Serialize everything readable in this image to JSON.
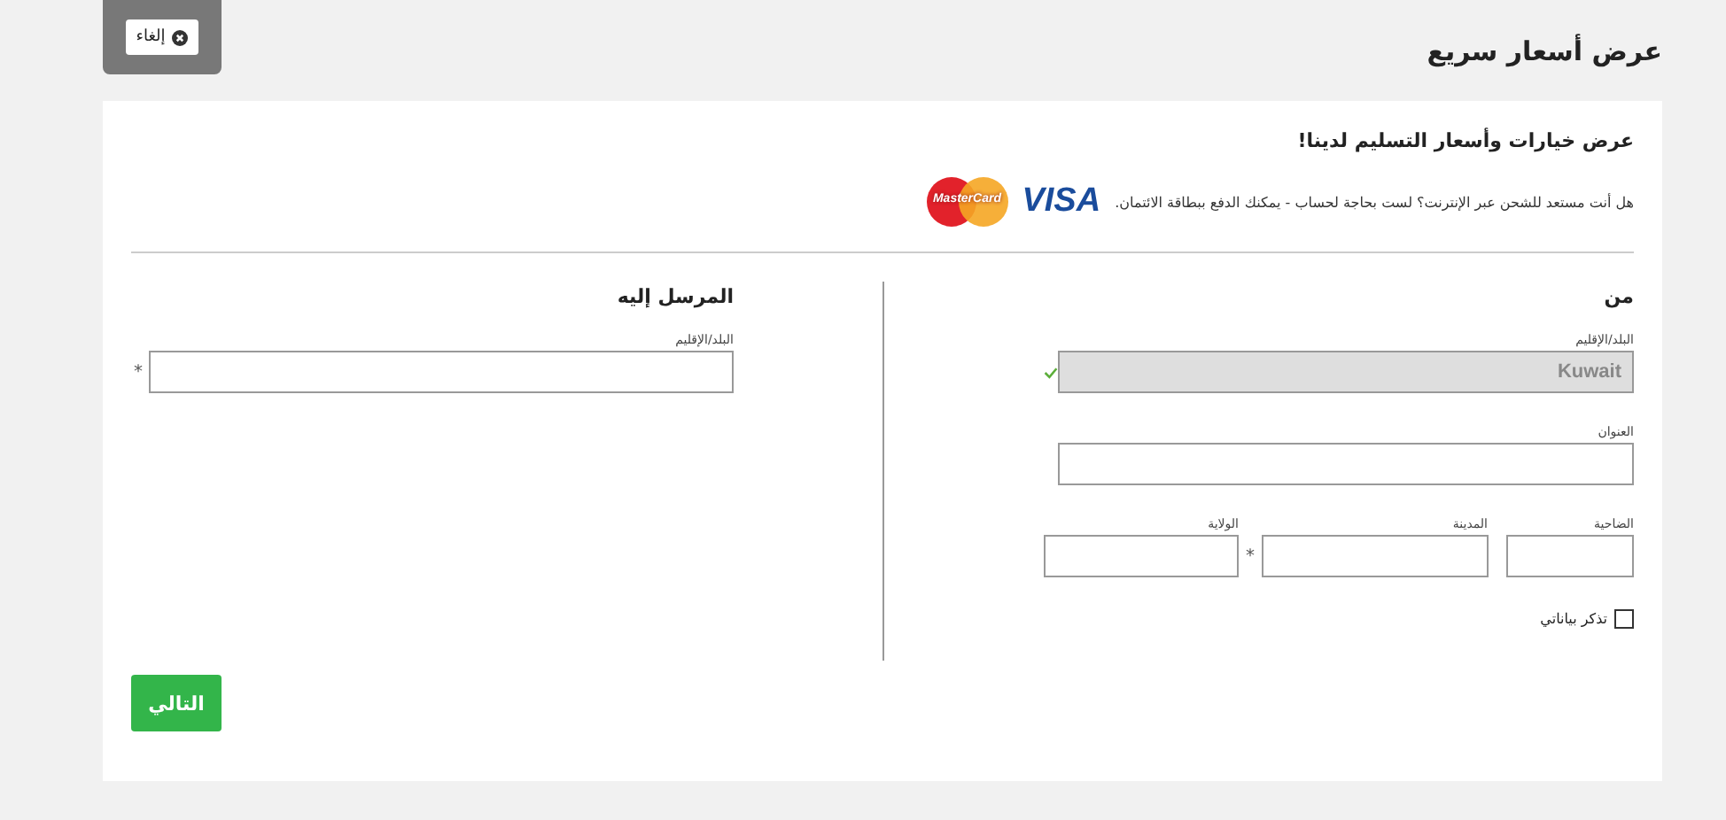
{
  "header": {
    "title": "عرض أسعار سريع",
    "cancel_button": "إلغاء"
  },
  "intro": {
    "title": "عرض خيارات وأسعار التسليم لدينا!",
    "text": "هل أنت مستعد للشحن عبر الإنترنت؟ لست بحاجة لحساب - يمكنك الدفع ببطاقة الائتمان.",
    "logos": [
      {
        "kind": "visa",
        "label": "VISA"
      },
      {
        "kind": "mastercard",
        "label": "MasterCard"
      }
    ]
  },
  "sender": {
    "title": "من",
    "rows": [
      [
        {
          "label": "البلد/الإقليم",
          "value": "Kuwait",
          "disabled": true,
          "verified": true
        }
      ],
      [
        {
          "label": "العنوان",
          "disabled": false,
          "verified": false
        }
      ],
      [
        {
          "label": "الضاحية",
          "disabled": false,
          "verified": false
        },
        {
          "label": "المدينة",
          "disabled": false,
          "verified": false,
          "required_mark": "*"
        },
        {
          "label": "الولاية",
          "disabled": false,
          "verified": false
        }
      ]
    ],
    "remember": {
      "label": "تذكر بياناتي",
      "checked": false
    }
  },
  "receiver": {
    "title": "المرسل إليه",
    "rows": [
      [
        {
          "label": "البلد/الإقليم",
          "disabled": false,
          "verified": false,
          "required_mark": "*"
        }
      ]
    ]
  },
  "next_button": "التالي"
}
